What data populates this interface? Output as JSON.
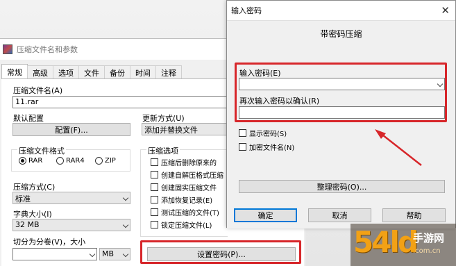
{
  "archive_dialog": {
    "title": "压缩文件名和参数",
    "tabs": [
      "常规",
      "高级",
      "选项",
      "文件",
      "备份",
      "时间",
      "注释"
    ],
    "archive_name_label": "压缩文件名(A)",
    "archive_name_value": "11.rar",
    "profiles_label": "默认配置",
    "profiles_button": "配置(F)...",
    "update_mode_label": "更新方式(U)",
    "update_mode_value": "添加并替换文件",
    "format_group": "压缩文件格式",
    "formats": [
      "RAR",
      "RAR4",
      "ZIP"
    ],
    "selected_format": "RAR",
    "method_label": "压缩方式(C)",
    "method_value": "标准",
    "dict_label": "字典大小(I)",
    "dict_value": "32 MB",
    "split_label": "切分为分卷(V)，大小",
    "split_unit": "MB",
    "options_group": "压缩选项",
    "options": [
      "压缩后删除原来的",
      "创建自解压格式压缩",
      "创建固实压缩文件",
      "添加恢复记录(E)",
      "测试压缩的文件(T)",
      "锁定压缩文件(L)"
    ],
    "set_password_button": "设置密码(P)..."
  },
  "password_dialog": {
    "title": "输入密码",
    "close_glyph": "✕",
    "heading": "带密码压缩",
    "enter_label": "输入密码(E)",
    "enter_value": "",
    "confirm_label": "再次输入密码以确认(R)",
    "confirm_value": "",
    "show_password": "显示密码(S)",
    "encrypt_names": "加密文件名(N)",
    "organize_button": "整理密码(O)...",
    "ok_button": "确定",
    "cancel_button": "取消",
    "help_button": "帮助"
  },
  "watermark": {
    "logo": "54ld",
    "name": "手游网",
    "url": ".com.cn"
  },
  "colors": {
    "highlight": "#d7262a",
    "watermark_orange": "#f2a115"
  }
}
